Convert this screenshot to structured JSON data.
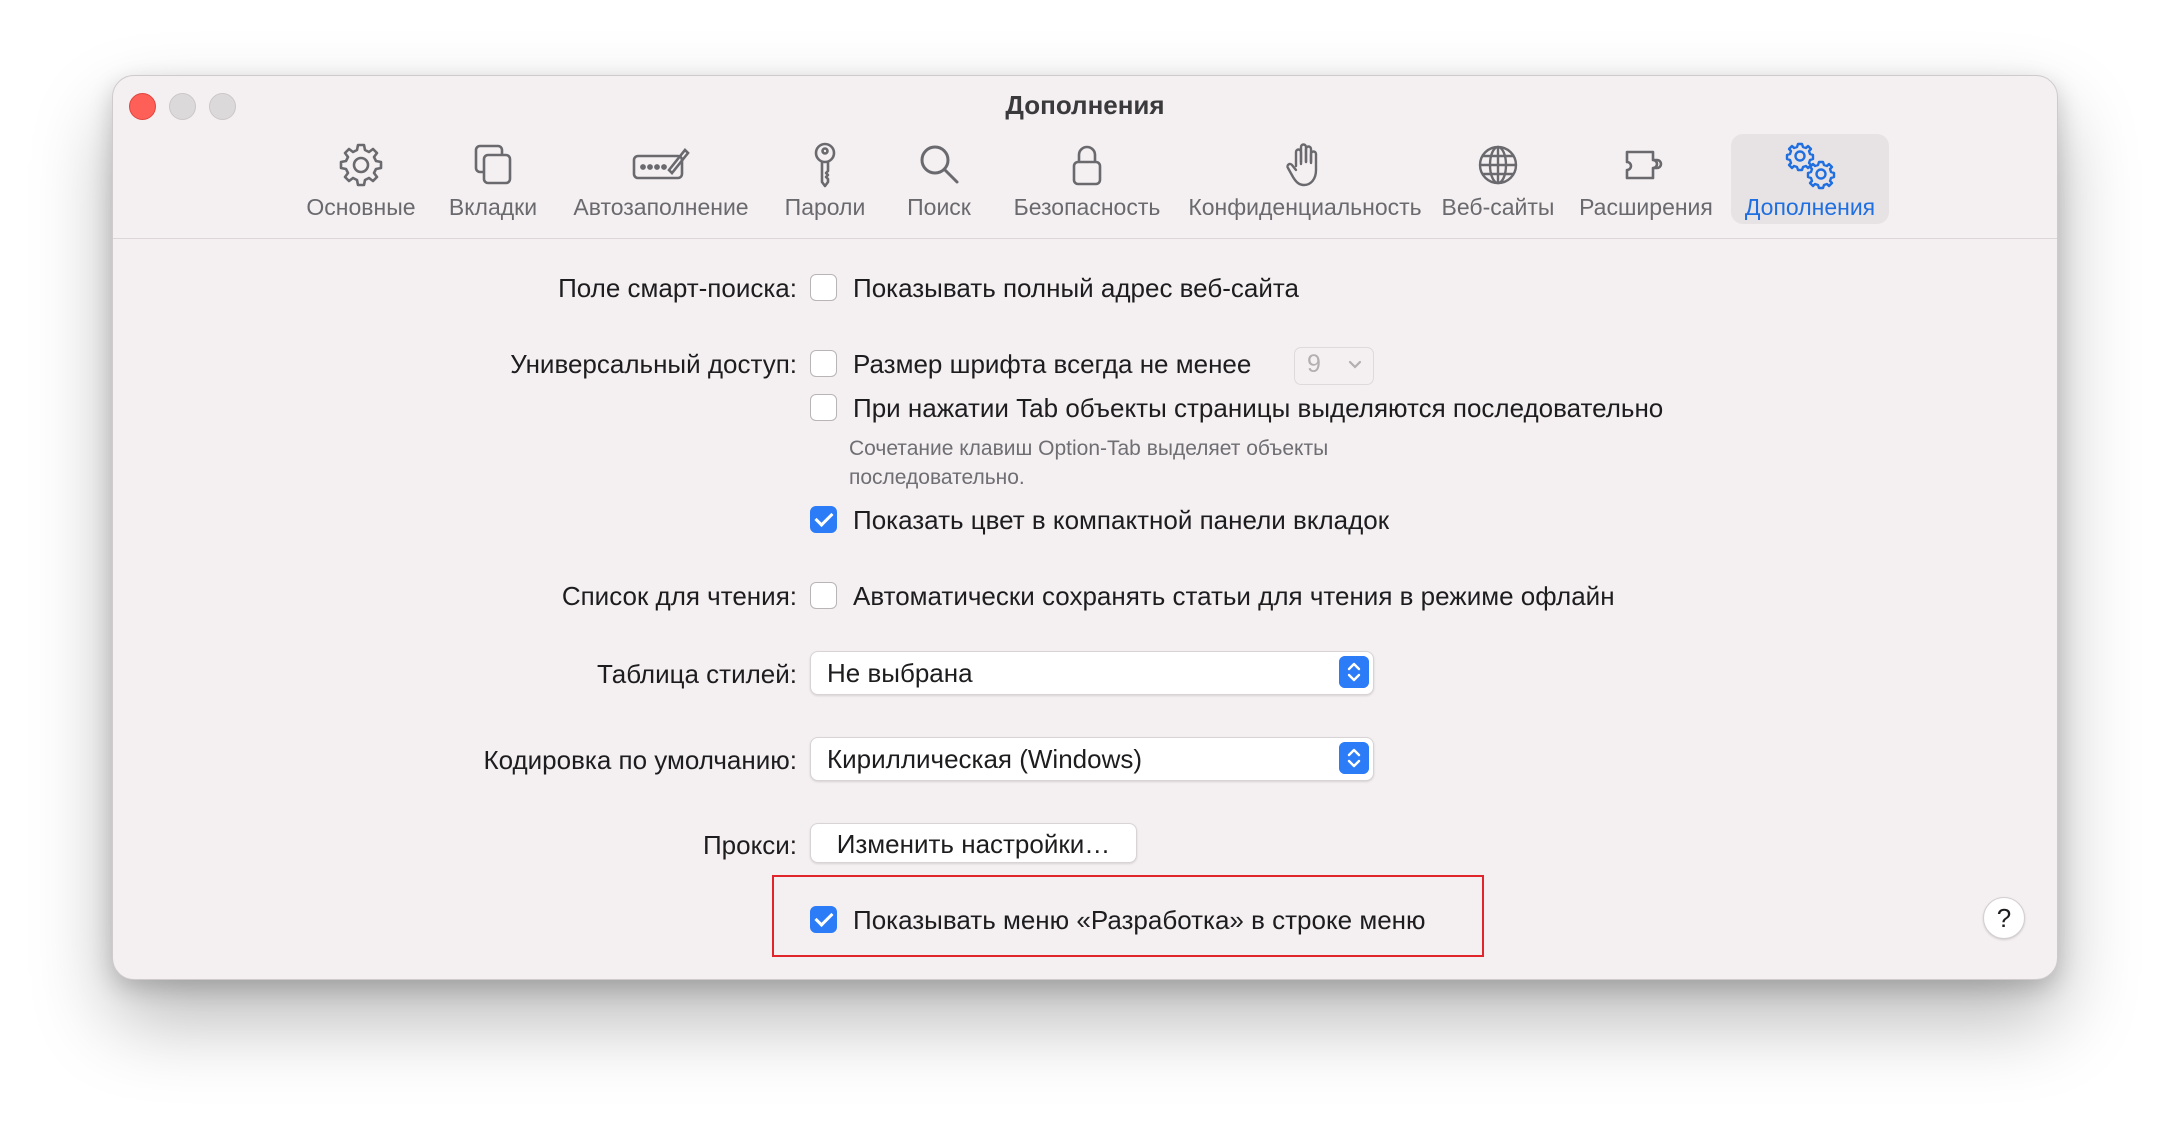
{
  "window": {
    "title": "Дополнения"
  },
  "tabs": [
    {
      "label": "Основные",
      "icon": "gear-icon"
    },
    {
      "label": "Вкладки",
      "icon": "tabs-icon"
    },
    {
      "label": "Автозаполнение",
      "icon": "autofill-icon"
    },
    {
      "label": "Пароли",
      "icon": "key-icon"
    },
    {
      "label": "Поиск",
      "icon": "search-icon"
    },
    {
      "label": "Безопасность",
      "icon": "lock-icon"
    },
    {
      "label": "Конфиденциальность",
      "icon": "hand-icon"
    },
    {
      "label": "Веб-сайты",
      "icon": "globe-icon"
    },
    {
      "label": "Расширения",
      "icon": "puzzle-icon"
    },
    {
      "label": "Дополнения",
      "icon": "gears-icon",
      "active": true
    }
  ],
  "settings": {
    "smart_search": {
      "label": "Поле смарт-поиска:",
      "option": "Показывать полный адрес веб-сайта",
      "checked": false
    },
    "accessibility": {
      "label": "Универсальный доступ:",
      "font_size_option": "Размер шрифта всегда не менее",
      "font_size_value": "9",
      "tab_option": "При нажатии Tab объекты страницы выделяются последовательно",
      "hint_line1": "Сочетание клавиш Option-Tab выделяет объекты",
      "hint_line2": "последовательно.",
      "color_option": "Показать цвет в компактной панели вкладок",
      "color_checked": true
    },
    "reading_list": {
      "label": "Список для чтения:",
      "option": "Автоматически сохранять статьи для чтения в режиме офлайн",
      "checked": false
    },
    "stylesheet": {
      "label": "Таблица стилей:",
      "value": "Не выбрана"
    },
    "encoding": {
      "label": "Кодировка по умолчанию:",
      "value": "Кириллическая (Windows)"
    },
    "proxy": {
      "label": "Прокси:",
      "button": "Изменить настройки…"
    },
    "develop_menu": {
      "option": "Показывать меню «Разработка» в строке меню",
      "checked": true
    }
  },
  "help": {
    "label": "?"
  },
  "colors": {
    "accent": "#2b7cf6",
    "highlight": "#e0262a",
    "active_tab_text": "#1f6fe0"
  }
}
